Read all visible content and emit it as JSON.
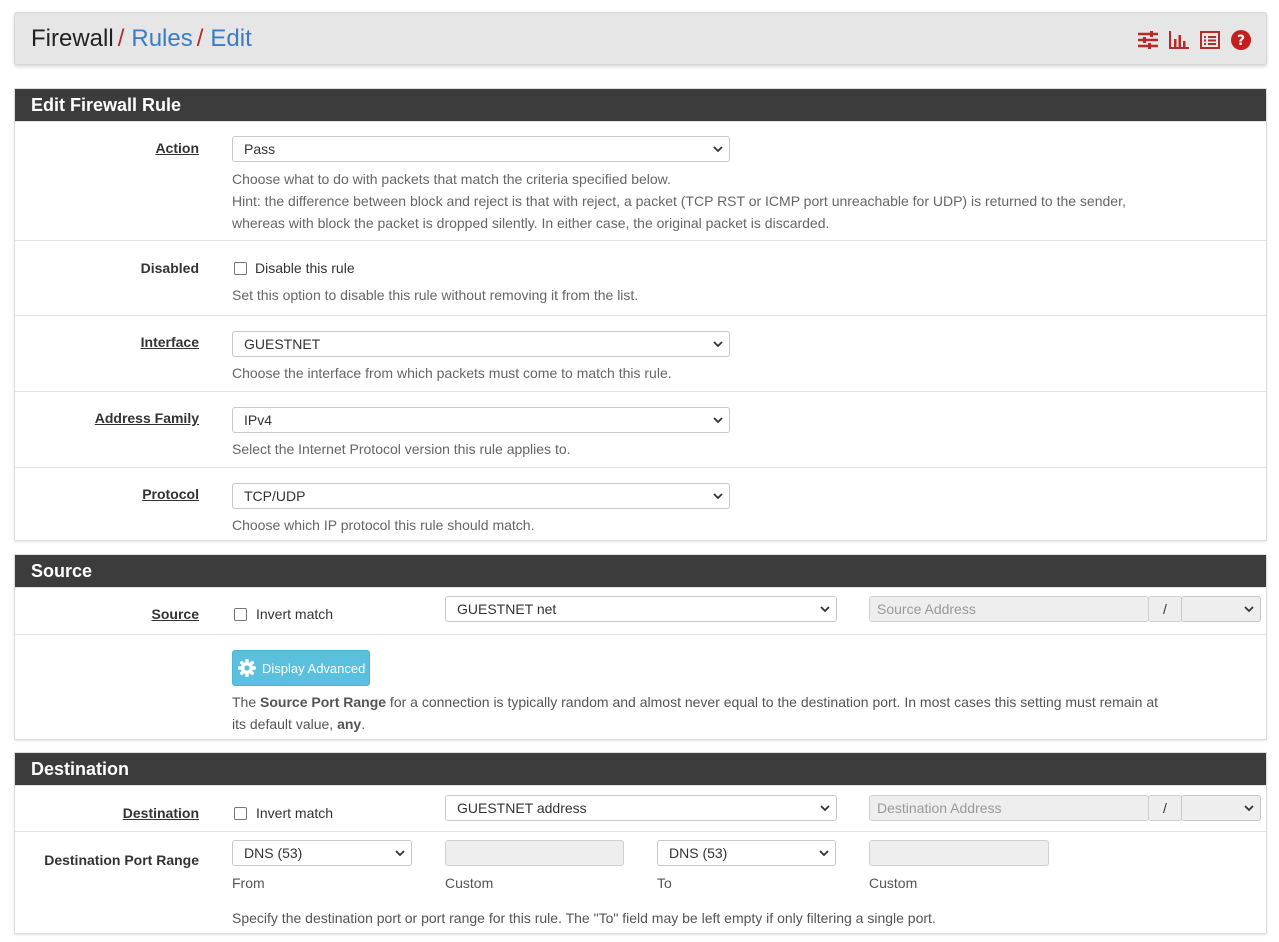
{
  "breadcrumb": {
    "root": "Firewall",
    "separator": "/",
    "level2": "Rules",
    "level3": "Edit"
  },
  "header_icons": [
    "sliders-icon",
    "bar-chart-icon",
    "list-icon",
    "help-circle-icon"
  ],
  "colors": {
    "panel_header": "#3c3c3c",
    "link": "#3a7cc3",
    "separator": "#b52a2a",
    "button_info": "#5bc0de"
  },
  "edit_panel": {
    "title": "Edit Firewall Rule",
    "action": {
      "label": "Action",
      "value": "Pass",
      "help1": "Choose what to do with packets that match the criteria specified below.",
      "help2": "Hint: the difference between block and reject is that with reject, a packet (TCP RST or ICMP port unreachable for UDP) is returned to the sender,",
      "help3": "whereas with block the packet is dropped silently. In either case, the original packet is discarded."
    },
    "disabled": {
      "label": "Disabled",
      "checkbox_label": "Disable this rule",
      "help": "Set this option to disable this rule without removing it from the list."
    },
    "interface": {
      "label": "Interface",
      "value": "GUESTNET",
      "help": "Choose the interface from which packets must come to match this rule."
    },
    "address_family": {
      "label": "Address Family",
      "value": "IPv4",
      "help": "Select the Internet Protocol version this rule applies to."
    },
    "protocol": {
      "label": "Protocol",
      "value": "TCP/UDP",
      "help": "Choose which IP protocol this rule should match."
    }
  },
  "source_panel": {
    "title": "Source",
    "label": "Source",
    "invert_label": "Invert match",
    "type_value": "GUESTNET net",
    "address_placeholder": "Source Address",
    "slash": "/",
    "advanced_button": "Display Advanced",
    "help_pre": "The ",
    "help_bold": "Source Port Range",
    "help_mid": " for a connection is typically random and almost never equal to the destination port. In most cases this setting must remain at",
    "help_line2_pre": "its default value, ",
    "help_line2_bold": "any",
    "help_line2_post": "."
  },
  "destination_panel": {
    "title": "Destination",
    "label": "Destination",
    "invert_label": "Invert match",
    "type_value": "GUESTNET address",
    "address_placeholder": "Destination Address",
    "slash": "/",
    "port_range_label": "Destination Port Range",
    "from_value": "DNS (53)",
    "to_value": "DNS (53)",
    "from_label": "From",
    "custom_label": "Custom",
    "to_label": "To",
    "custom_label2": "Custom",
    "help": "Specify the destination port or port range for this rule. The \"To\" field may be left empty if only filtering a single port."
  }
}
